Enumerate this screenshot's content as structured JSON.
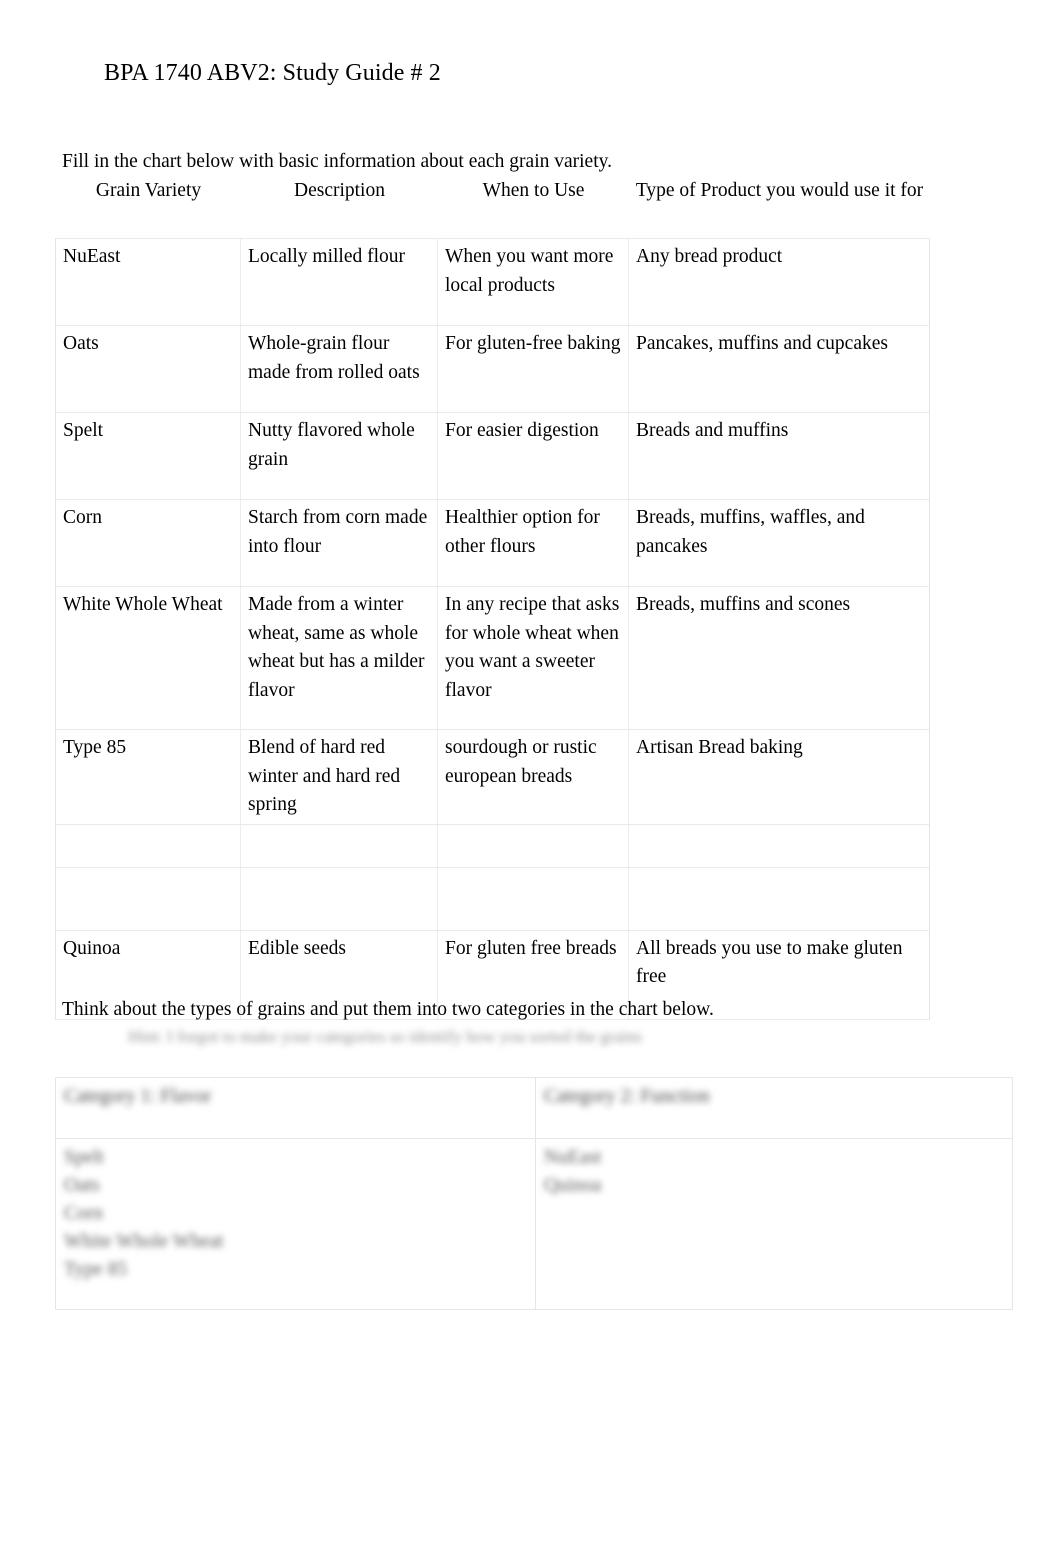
{
  "document": {
    "title": "BPA 1740 ABV2: Study Guide # 2"
  },
  "instructions": {
    "chart_one": "Fill in the chart below with basic information about each grain variety.",
    "chart_two": "Think about the types of grains and put them into two categories in the chart below.",
    "hint_line": "Hint: I forgot to make your categories so identify how you sorted the grains"
  },
  "grain_table": {
    "headers": [
      "Grain Variety",
      "Description",
      "When to Use",
      "Type of Product you would use it for"
    ],
    "rows": [
      {
        "variety": "NuEast",
        "description": "Locally milled flour",
        "when_to_use": "When you want more local products",
        "product_type": "Any bread product"
      },
      {
        "variety": "Oats",
        "description": "Whole-grain flour made from rolled oats",
        "when_to_use": "For gluten-free baking",
        "product_type": "Pancakes, muffins and cupcakes"
      },
      {
        "variety": "Spelt",
        "description": "Nutty flavored whole grain",
        "when_to_use": "For easier digestion",
        "product_type": "Breads and muffins"
      },
      {
        "variety": "Corn",
        "description": "Starch from corn made into flour",
        "when_to_use": "Healthier option for other flours",
        "product_type": "Breads, muffins, waffles, and pancakes"
      },
      {
        "variety": "White Whole Wheat",
        "description": "Made from a winter wheat, same as whole wheat but has a milder flavor",
        "when_to_use": "In any recipe that asks for whole wheat when you want a sweeter flavor",
        "product_type": "Breads, muffins and scones"
      },
      {
        "variety": "Type 85",
        "description": "Blend of hard red winter and hard red spring",
        "when_to_use": "sourdough or rustic european breads",
        "product_type": "Artisan Bread baking"
      },
      {
        "variety": "",
        "description": "",
        "when_to_use": "",
        "product_type": ""
      },
      {
        "variety": "",
        "description": "",
        "when_to_use": "",
        "product_type": ""
      },
      {
        "variety": "Quinoa",
        "description": "Edible seeds",
        "when_to_use": "For gluten free breads",
        "product_type": "All breads you use to make gluten free"
      }
    ]
  },
  "category_table": {
    "left": {
      "header": "Category 1: Flavor",
      "items": [
        "Spelt",
        "Oats",
        "Corn",
        "White Whole Wheat",
        "Type 85"
      ]
    },
    "right": {
      "header": "Category 2: Function",
      "items": [
        "NuEast",
        "Quinoa"
      ]
    }
  }
}
